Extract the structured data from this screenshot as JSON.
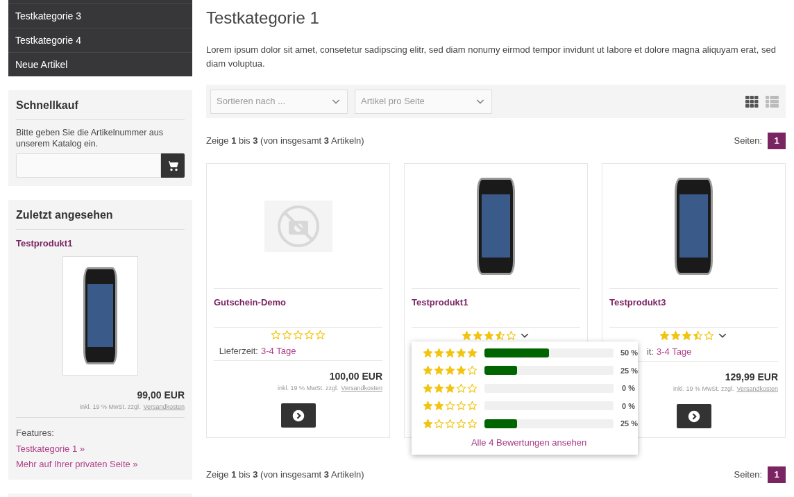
{
  "sidebar": {
    "categories": [
      {
        "label": "Testkategorie 3"
      },
      {
        "label": "Testkategorie 4"
      },
      {
        "label": "Neue Artikel"
      }
    ],
    "quick_buy": {
      "title": "Schnellkauf",
      "text": "Bitte geben Sie die Artikelnummer aus unserem Katalog ein."
    },
    "recently_viewed": {
      "title": "Zuletzt angesehen",
      "product": "Testprodukt1",
      "price": "99,00 EUR",
      "tax_note": "inkl. 19 % MwSt. zzgl.",
      "shipping_link": "Versandkosten",
      "features_label": "Features:",
      "links": [
        "Testkategorie 1 »",
        "Mehr auf Ihrer privaten Seite »"
      ]
    }
  },
  "page": {
    "title": "Testkategorie 1",
    "description": "Lorem ipsum dolor sit amet, consetetur sadipscing elitr, sed diam nonumy eirmod tempor invidunt ut labore et dolore magna aliquyam erat, sed diam voluptua."
  },
  "toolbar": {
    "sort_placeholder": "Sortieren nach ...",
    "per_page_placeholder": "Artikel pro Seite",
    "views": [
      {
        "kind": "grid",
        "selected": true
      },
      {
        "kind": "list",
        "selected": false
      }
    ]
  },
  "pagination_top": {
    "summary": "Zeige **1** bis **3** (von insgesamt **3** Artikeln)",
    "label": "Seiten:",
    "pages": [
      {
        "label": "1",
        "selected": true
      }
    ]
  },
  "products": [
    {
      "name": "Gutschein-Demo",
      "stars": 0,
      "dropdown": false,
      "delivery_label": "Lieferzeit:",
      "delivery": "3-4 Tage",
      "price": "100,00 EUR",
      "tax_note": "inkl. 19 % MwSt. zzgl.",
      "shipping_link": "Versandkosten"
    },
    {
      "name": "Testprodukt1",
      "stars": 3.5,
      "dropdown": true
    },
    {
      "name": "Testprodukt3",
      "stars": 3.5,
      "dropdown": true,
      "delivery_label": "it:",
      "delivery": "3-4 Tage",
      "price": "129,99 EUR",
      "tax_note": "inkl. 19 % MwSt. zzgl.",
      "shipping_link": "Versandkosten"
    }
  ],
  "rating_popup": {
    "rows": [
      {
        "stars": 5,
        "level": 0.5,
        "reading": "50 %"
      },
      {
        "stars": 4,
        "level": 0.25,
        "reading": "25 %"
      },
      {
        "stars": 3,
        "level": 0,
        "reading": "0 %"
      },
      {
        "stars": 2,
        "level": 0,
        "reading": "0 %"
      },
      {
        "stars": 1,
        "level": 0.25,
        "reading": "25 %"
      }
    ],
    "link": "Alle 4 Bewertungen ansehen"
  },
  "pagination_bottom": {
    "summary": "Zeige **1** bis **3** (von insgesamt **3** Artikeln)",
    "label": "Seiten:",
    "pages": [
      {
        "label": "1",
        "selected": true
      }
    ]
  }
}
